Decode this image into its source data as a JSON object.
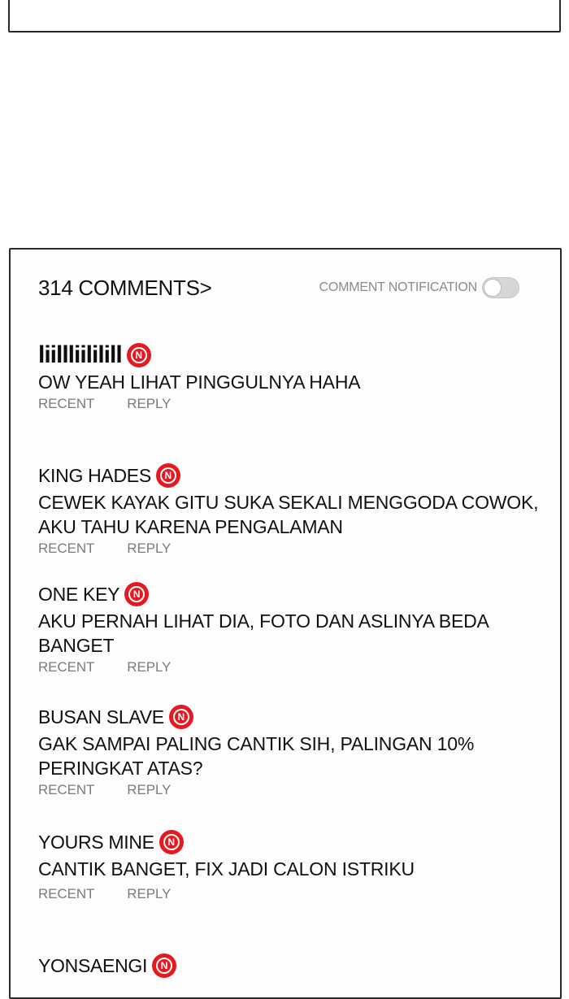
{
  "header": {
    "comment_count": "314 COMMENTS>",
    "notification_label": "COMMENT NOTIFICATION",
    "notification_on": false
  },
  "badge": {
    "letter": "N",
    "color": "#e5191f"
  },
  "comments": [
    {
      "author": "liillliililill",
      "text": "OW YEAH LIHAT PINGGULNYA HAHA",
      "recent": "RECENT",
      "reply": "REPLY"
    },
    {
      "author": "KING HADES",
      "text": "CEWEK KAYAK GITU SUKA SEKALI MENGGODA COWOK, AKU TAHU KARENA PENGALAMAN",
      "recent": "RECENT",
      "reply": "REPLY"
    },
    {
      "author": "ONE KEY",
      "text": "AKU PERNAH LIHAT DIA, FOTO DAN ASLINYA BEDA BANGET",
      "recent": "RECENT",
      "reply": "REPLY"
    },
    {
      "author": "BUSAN SLAVE",
      "text": "GAK SAMPAI PALING CANTIK SIH, PALINGAN 10% PERINGKAT ATAS?",
      "recent": "RECENT",
      "reply": "REPLY"
    },
    {
      "author": "YOURS MINE",
      "text": "CANTIK BANGET, FIX JADI CALON ISTRIKU",
      "recent": "RECENT",
      "reply": "REPLY"
    },
    {
      "author": "YONSAENGI"
    }
  ]
}
